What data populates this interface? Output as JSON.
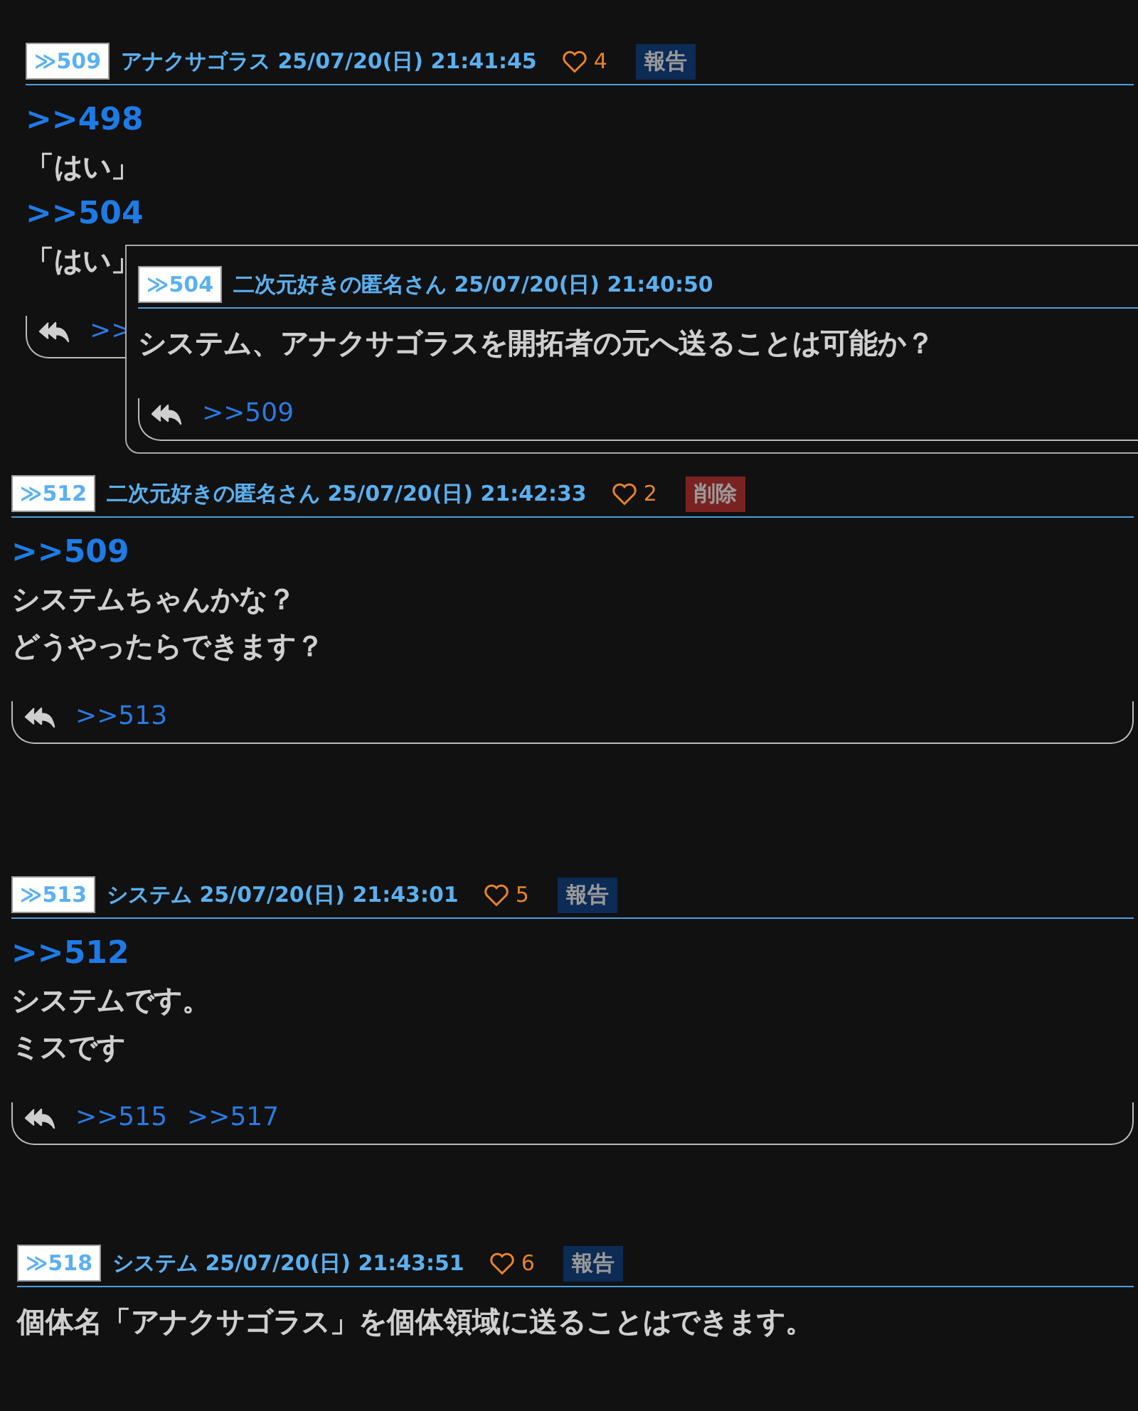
{
  "posts": [
    {
      "number": "≫509",
      "header": "アナクサゴラス 25/07/20(日) 21:41:45",
      "likes": "4",
      "action": {
        "kind": "report",
        "label": "報告"
      },
      "body": [
        {
          "kind": "anchor",
          "text": ">>498"
        },
        {
          "kind": "text",
          "text": "「はい」"
        },
        {
          "kind": "anchor",
          "text": ">>504"
        },
        {
          "kind": "text",
          "text": "「はい」"
        }
      ],
      "replies": [
        ">>"
      ]
    },
    {
      "number": "≫512",
      "header": "二次元好きの匿名さん 25/07/20(日) 21:42:33",
      "likes": "2",
      "action": {
        "kind": "delete",
        "label": "削除"
      },
      "body": [
        {
          "kind": "anchor",
          "text": ">>509"
        },
        {
          "kind": "text",
          "text": "システムちゃんかな？"
        },
        {
          "kind": "text",
          "text": "どうやったらできます？"
        }
      ],
      "replies": [
        ">>513"
      ]
    },
    {
      "number": "≫513",
      "header": "システム 25/07/20(日) 21:43:01",
      "likes": "5",
      "action": {
        "kind": "report",
        "label": "報告"
      },
      "body": [
        {
          "kind": "anchor",
          "text": ">>512"
        },
        {
          "kind": "text",
          "text": "システムです。"
        },
        {
          "kind": "text",
          "text": "ミスです"
        }
      ],
      "replies": [
        ">>515",
        ">>517"
      ]
    },
    {
      "number": "≫518",
      "header": "システム 25/07/20(日) 21:43:51",
      "likes": "6",
      "action": {
        "kind": "report",
        "label": "報告"
      },
      "body": [
        {
          "kind": "text",
          "text": "個体名「アナクサゴラス」を個体領域に送ることはできます。"
        }
      ]
    }
  ],
  "popup": {
    "number": "≫504",
    "header": "二次元好きの匿名さん 25/07/20(日) 21:40:50",
    "body": [
      {
        "kind": "text",
        "text": "システム、アナクサゴラスを開拓者の元へ送ることは可能か？"
      }
    ],
    "replies": [
      ">>509"
    ]
  }
}
